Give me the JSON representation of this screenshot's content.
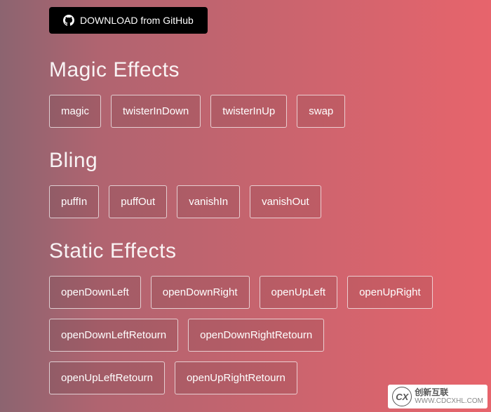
{
  "download": {
    "label": "DOWNLOAD from GitHub"
  },
  "sections": {
    "magic": {
      "title": "Magic Effects",
      "items": [
        "magic",
        "twisterInDown",
        "twisterInUp",
        "swap"
      ]
    },
    "bling": {
      "title": "Bling",
      "items": [
        "puffIn",
        "puffOut",
        "vanishIn",
        "vanishOut"
      ]
    },
    "static": {
      "title": "Static Effects",
      "items": [
        "openDownLeft",
        "openDownRight",
        "openUpLeft",
        "openUpRight",
        "openDownLeftRetourn",
        "openDownRightRetourn",
        "openUpLeftRetourn",
        "openUpRightRetourn"
      ]
    }
  },
  "watermark": {
    "logo": "CX",
    "line1": "创新互联",
    "line2": "WWW.CDCXHL.COM"
  }
}
